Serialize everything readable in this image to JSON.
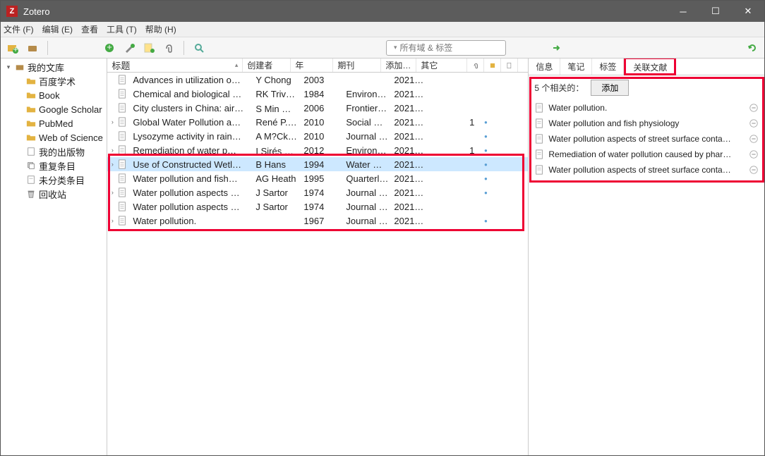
{
  "title": "Zotero",
  "menu": [
    "文件 (F)",
    "编辑 (E)",
    "查看",
    "工具 (T)",
    "帮助 (H)"
  ],
  "search_placeholder": "所有域 & 标签",
  "sidebar": [
    {
      "label": "我的文库",
      "twisty": "▾",
      "icon": "box"
    },
    {
      "label": "百度学术",
      "indent": 1,
      "icon": "folder"
    },
    {
      "label": "Book",
      "indent": 1,
      "icon": "folder"
    },
    {
      "label": "Google Scholar",
      "indent": 1,
      "icon": "folder"
    },
    {
      "label": "PubMed",
      "indent": 1,
      "icon": "folder"
    },
    {
      "label": "Web of Science",
      "indent": 1,
      "icon": "folder"
    },
    {
      "label": "我的出版物",
      "indent": 1,
      "icon": "doc"
    },
    {
      "label": "重复条目",
      "indent": 1,
      "icon": "dup"
    },
    {
      "label": "未分类条目",
      "indent": 1,
      "icon": "unf"
    },
    {
      "label": "回收站",
      "indent": 1,
      "icon": "trash"
    }
  ],
  "cols": {
    "title": "标题",
    "creator": "创建者",
    "year": "年",
    "pub": "期刊",
    "date": "添加…",
    "other": "其它"
  },
  "rows": [
    {
      "t": "Advances in utilization o…",
      "c": "Y Chong",
      "y": "2003",
      "p": "",
      "d": "2021/…"
    },
    {
      "t": "Chemical and biological …",
      "c": "RK Trivedy",
      "y": "1984",
      "p": "Environ…",
      "d": "2021/…"
    },
    {
      "t": "City clusters in China: air…",
      "c": "S Min 等。",
      "y": "2006",
      "p": "Frontiers…",
      "d": "2021/…"
    },
    {
      "t": "Global Water Pollution a…",
      "c": "René P. …",
      "y": "2010",
      "p": "Social Sc…",
      "d": "2021/…",
      "tw": "›",
      "o": "1",
      "att": "●"
    },
    {
      "t": "Lysozyme activity in rain…",
      "c": "A M?Ck …",
      "y": "2010",
      "p": "Journal …",
      "d": "2021/…",
      "att": "●"
    },
    {
      "t": "Remediation of water p…",
      "c": "I Sirés 和 …",
      "y": "2012",
      "p": "Environ…",
      "d": "2021/…",
      "tw": "›",
      "o": "1",
      "att": "●"
    },
    {
      "t": "Use of Constructed Wetl…",
      "c": "B Hans",
      "y": "1994",
      "p": "Water Q…",
      "d": "2021/…",
      "tw": "›",
      "att": "●",
      "sel": true
    },
    {
      "t": "Water pollution and fish…",
      "c": "AG Heath",
      "y": "1995",
      "p": "Quarterl…",
      "d": "2021/…",
      "att": "●"
    },
    {
      "t": "Water pollution aspects …",
      "c": "J Sartor",
      "y": "1974",
      "p": "Journal (…",
      "d": "2021/…",
      "tw": "›",
      "att": "●"
    },
    {
      "t": "Water pollution aspects …",
      "c": "J Sartor",
      "y": "1974",
      "p": "Journal (…",
      "d": "2021/…"
    },
    {
      "t": "Water pollution.",
      "c": "",
      "y": "1967",
      "p": "Journal -…",
      "d": "2021/…",
      "tw": "›",
      "att": "●"
    }
  ],
  "rtabs": [
    "信息",
    "笔记",
    "标签",
    "关联文献"
  ],
  "related_count": "5 个相关的：",
  "add_label": "添加",
  "related": [
    "Water pollution.",
    "Water pollution and fish physiology",
    "Water pollution aspects of street surface conta…",
    "Remediation of water pollution caused by phar…",
    "Water pollution aspects of street surface conta…"
  ]
}
